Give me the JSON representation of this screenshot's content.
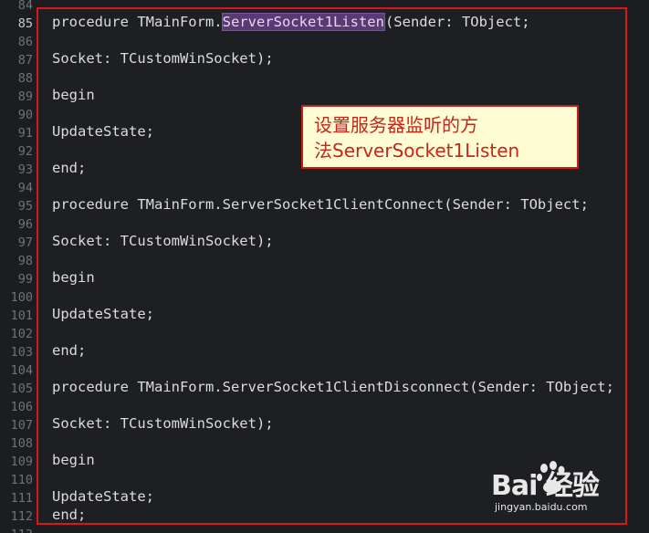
{
  "line_numbers": [
    "84",
    "85",
    "86",
    "87",
    "88",
    "89",
    "90",
    "91",
    "92",
    "93",
    "94",
    "95",
    "96",
    "97",
    "98",
    "99",
    "100",
    "101",
    "102",
    "103",
    "104",
    "105",
    "106",
    "107",
    "108",
    "109",
    "110",
    "111",
    "112",
    "113"
  ],
  "current_line": "85",
  "code": {
    "l85_prefix": "procedure TMainForm.",
    "l85_selected": "ServerSocket1Listen",
    "l85_suffix": "(Sender: TObject;",
    "l87": "Socket: TCustomWinSocket);",
    "l89": "begin",
    "l91": "UpdateState;",
    "l93": "end;",
    "l95": "procedure TMainForm.ServerSocket1ClientConnect(Sender: TObject;",
    "l97": "Socket: TCustomWinSocket);",
    "l99": "begin",
    "l101": "UpdateState;",
    "l103": "end;",
    "l105": "procedure TMainForm.ServerSocket1ClientDisconnect(Sender: TObject;",
    "l107": "Socket: TCustomWinSocket);",
    "l109": "begin",
    "l111": "UpdateState;",
    "l112": "end;"
  },
  "annotation": {
    "line1": "设置服务器监听的方",
    "line2": "法ServerSocket1Listen"
  },
  "watermark": {
    "brand": "Bai  经验",
    "url": "jingyan.baidu.com"
  },
  "colors": {
    "background": "#1c1d20",
    "frame_border": "#d8161b",
    "selection": "#5a3a74",
    "callout_bg": "#fffdd3",
    "callout_text": "#c8251b"
  }
}
